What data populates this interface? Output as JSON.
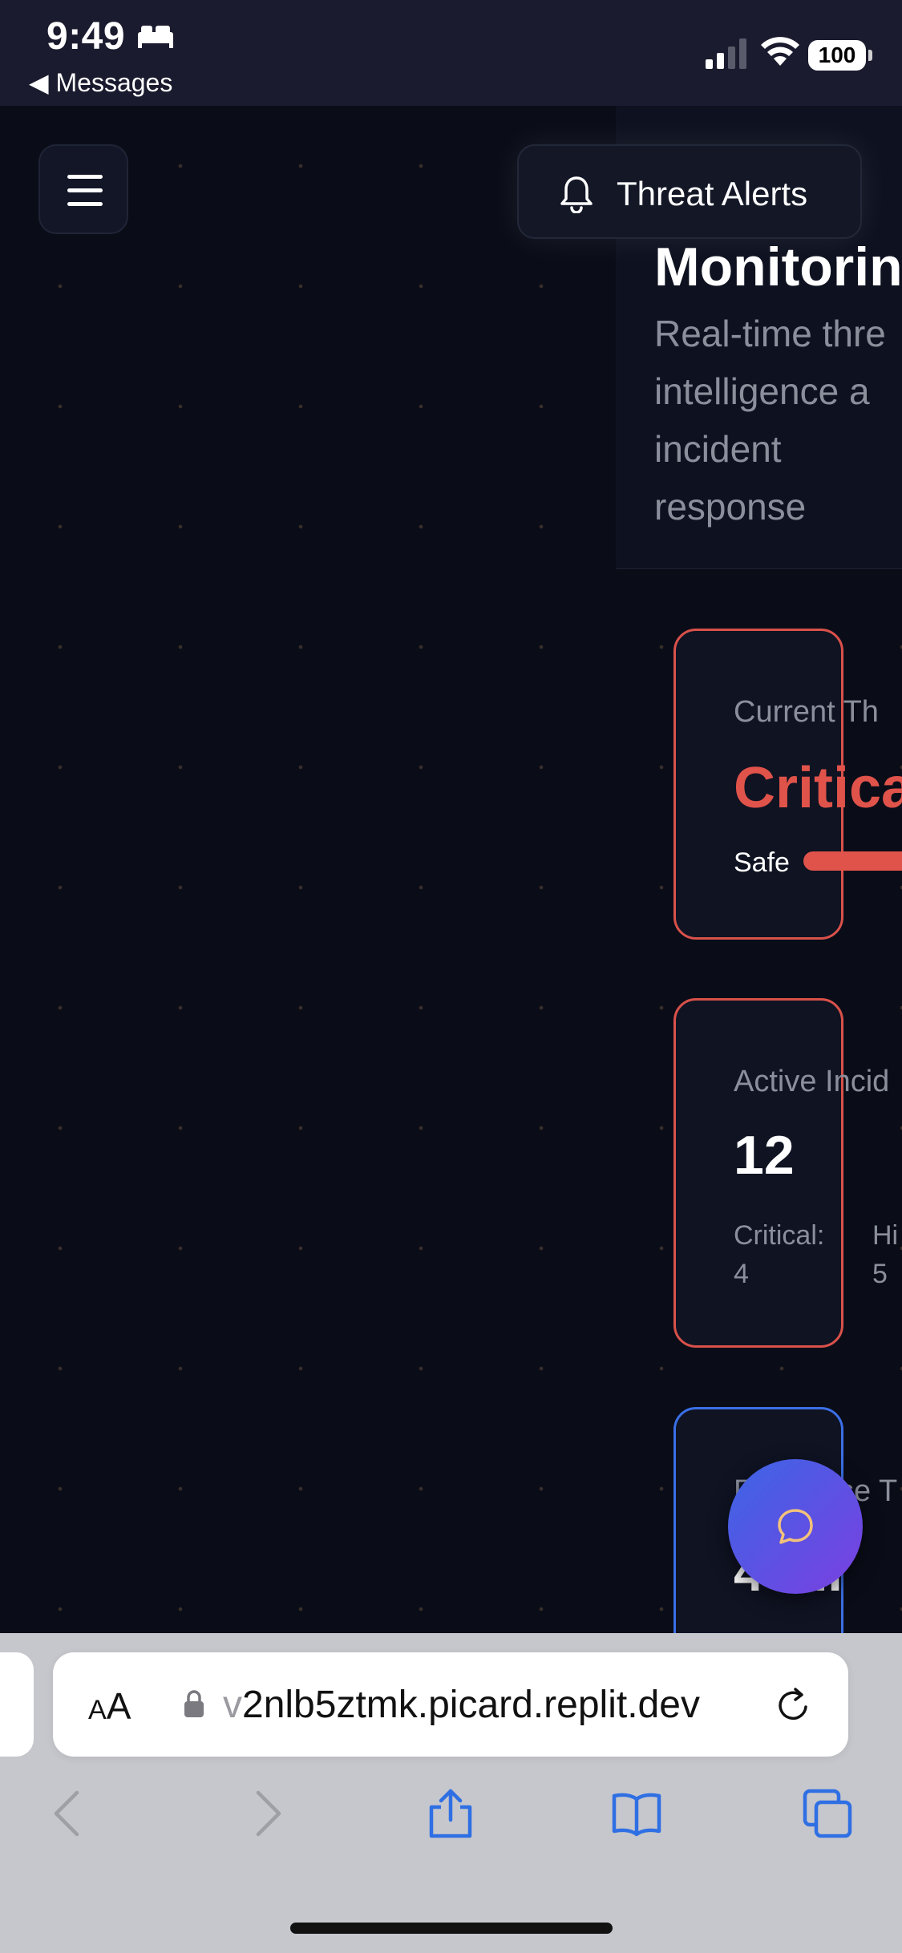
{
  "status_bar": {
    "time": "9:49",
    "back_label": "◀ Messages",
    "battery": "100",
    "icons": [
      "bed-icon",
      "signal-icon",
      "wifi-icon",
      "battery-icon"
    ]
  },
  "header": {
    "menu_icon": "hamburger-menu-icon",
    "alerts_label": "Threat Alerts",
    "alerts_icon": "bell-icon"
  },
  "hero": {
    "title": "Monitorin",
    "subtitle": "Real-time thre intelligence a incident response"
  },
  "cards": {
    "threat": {
      "label": "Current Th",
      "value": "Critica",
      "scale_start": "Safe",
      "color": "#e0534a"
    },
    "incidents": {
      "label": "Active Incid",
      "count": "12",
      "critical": "Critical: 4",
      "high": "Hi 5"
    },
    "response": {
      "label": "Response T",
      "value": "4 mi",
      "border_color": "#3b6fe6"
    }
  },
  "chat": {
    "icon": "chat-bubble-icon"
  },
  "browser": {
    "aa_label": "AA",
    "url_faded": "v",
    "url": "2nlb5ztmk.picard.replit.dev",
    "icons": [
      "lock-icon",
      "reload-icon",
      "back-arrow-icon",
      "forward-arrow-icon",
      "share-icon",
      "bookmarks-icon",
      "tabs-icon"
    ]
  }
}
